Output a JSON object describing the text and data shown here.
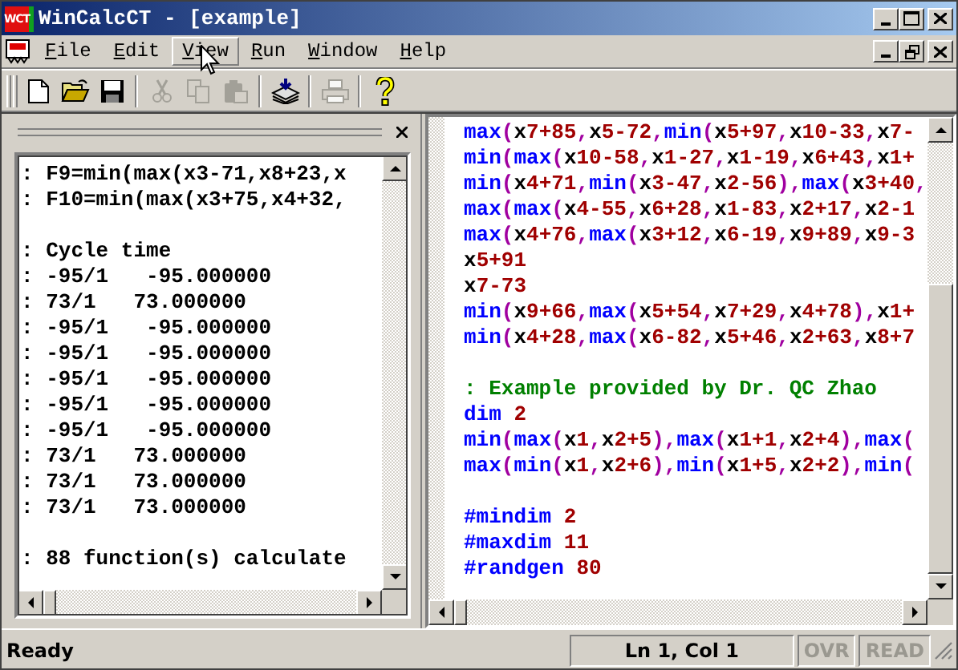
{
  "window": {
    "app_icon_text": "WCT",
    "title": "WinCalcCT - [example]"
  },
  "menu": [
    {
      "label": "File",
      "highlighted": false
    },
    {
      "label": "Edit",
      "highlighted": false
    },
    {
      "label": "View",
      "highlighted": true
    },
    {
      "label": "Run",
      "highlighted": false
    },
    {
      "label": "Window",
      "highlighted": false
    },
    {
      "label": "Help",
      "highlighted": false
    }
  ],
  "toolbar": [
    {
      "kind": "new",
      "disabled": false
    },
    {
      "kind": "open",
      "disabled": false
    },
    {
      "kind": "save",
      "disabled": false
    },
    {
      "kind": "separator"
    },
    {
      "kind": "cut",
      "disabled": true
    },
    {
      "kind": "copy",
      "disabled": true
    },
    {
      "kind": "paste",
      "disabled": true
    },
    {
      "kind": "separator"
    },
    {
      "kind": "compile",
      "disabled": false
    },
    {
      "kind": "separator"
    },
    {
      "kind": "print",
      "disabled": true
    },
    {
      "kind": "separator"
    },
    {
      "kind": "help",
      "disabled": false
    }
  ],
  "output_pane": {
    "lines": [
      {
        "kind": "text",
        "text": ": F9=min(max(x3-71,x8+23,x"
      },
      {
        "kind": "text",
        "text": ": F10=min(max(x3+75,x4+32,"
      },
      {
        "kind": "blank"
      },
      {
        "kind": "text",
        "text": ": Cycle time"
      },
      {
        "kind": "text",
        "text": ": -95/1   -95.000000"
      },
      {
        "kind": "text",
        "text": ": 73/1   73.000000"
      },
      {
        "kind": "text",
        "text": ": -95/1   -95.000000"
      },
      {
        "kind": "text",
        "text": ": -95/1   -95.000000"
      },
      {
        "kind": "text",
        "text": ": -95/1   -95.000000"
      },
      {
        "kind": "text",
        "text": ": -95/1   -95.000000"
      },
      {
        "kind": "text",
        "text": ": -95/1   -95.000000"
      },
      {
        "kind": "text",
        "text": ": 73/1   73.000000"
      },
      {
        "kind": "text",
        "text": ": 73/1   73.000000"
      },
      {
        "kind": "text",
        "text": ": 73/1   73.000000"
      },
      {
        "kind": "blank"
      },
      {
        "kind": "text",
        "text": ": 88 function(s) calculate"
      }
    ]
  },
  "editor": {
    "lines": [
      {
        "kind": "code",
        "text": "max(x7+85,x5-72,min(x5+97,x10-33,x7-"
      },
      {
        "kind": "code",
        "text": "min(max(x10-58,x1-27,x1-19,x6+43,x1+"
      },
      {
        "kind": "code",
        "text": "min(x4+71,min(x3-47,x2-56),max(x3+40,"
      },
      {
        "kind": "code",
        "text": "max(max(x4-55,x6+28,x1-83,x2+17,x2-1"
      },
      {
        "kind": "code",
        "text": "max(x4+76,max(x3+12,x6-19,x9+89,x9-3"
      },
      {
        "kind": "code",
        "text": "x5+91"
      },
      {
        "kind": "code",
        "text": "x7-73"
      },
      {
        "kind": "code",
        "text": "min(x9+66,max(x5+54,x7+29,x4+78),x1+"
      },
      {
        "kind": "code",
        "text": "min(x4+28,max(x6-82,x5+46,x2+63,x8+7"
      },
      {
        "kind": "blank"
      },
      {
        "kind": "comment",
        "text": ": Example provided by Dr. QC Zhao"
      },
      {
        "kind": "code",
        "text": "dim 2"
      },
      {
        "kind": "code",
        "text": "min(max(x1,x2+5),max(x1+1,x2+4),max("
      },
      {
        "kind": "code",
        "text": "max(min(x1,x2+6),min(x1+5,x2+2),min("
      },
      {
        "kind": "blank"
      },
      {
        "kind": "code",
        "text": "#mindim 2"
      },
      {
        "kind": "code",
        "text": "#maxdim 11"
      },
      {
        "kind": "code",
        "text": "#randgen 80"
      }
    ]
  },
  "status_bar": {
    "message": "Ready",
    "position": "Ln 1, Col 1",
    "indicators": [
      {
        "label": "OVR",
        "disabled": true
      },
      {
        "label": "READ",
        "disabled": true
      }
    ]
  }
}
